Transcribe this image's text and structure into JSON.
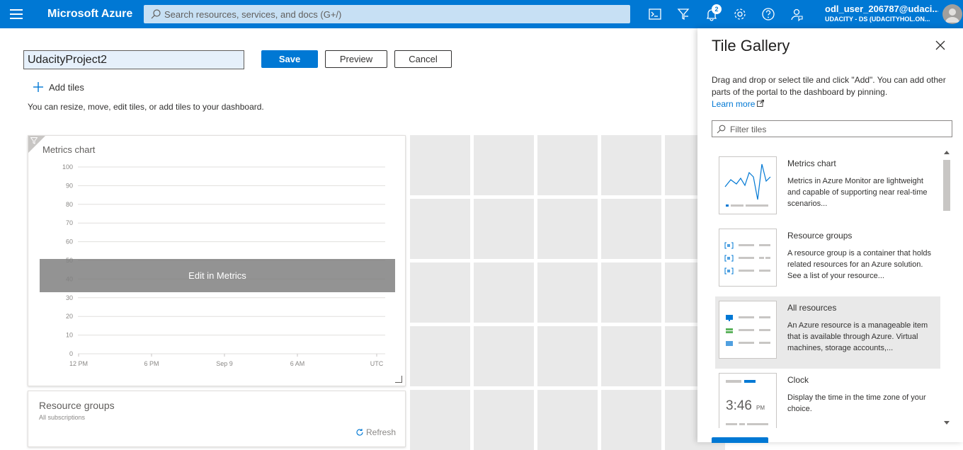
{
  "topbar": {
    "brand": "Microsoft Azure",
    "search_placeholder": "Search resources, services, and docs (G+/)",
    "notification_count": "2",
    "account_name": "odl_user_206787@udaci...",
    "account_org": "UDACITY - DS (UDACITYHOL.ON..."
  },
  "editor": {
    "dashboard_name": "UdacityProject2",
    "save_label": "Save",
    "preview_label": "Preview",
    "cancel_label": "Cancel",
    "add_tiles_label": "Add tiles",
    "helper_text": "You can resize, move, edit tiles, or add tiles to your dashboard."
  },
  "metrics_tile": {
    "title": "Metrics chart",
    "overlay_label": "Edit in Metrics"
  },
  "chart_data": {
    "type": "line",
    "title": "Metrics chart",
    "y_ticks": [
      "100",
      "90",
      "80",
      "70",
      "60",
      "50",
      "40",
      "30",
      "20",
      "10",
      "0"
    ],
    "x_ticks": [
      "12 PM",
      "6 PM",
      "Sep 9",
      "6 AM",
      "UTC"
    ],
    "ylim": [
      0,
      100
    ],
    "series": []
  },
  "resource_groups_tile": {
    "title": "Resource groups",
    "subtitle": "All subscriptions",
    "refresh_label": "Refresh"
  },
  "tile_gallery": {
    "title": "Tile Gallery",
    "description": "Drag and drop or select tile and click \"Add\". You can add other parts of the portal to the dashboard by pinning.",
    "learn_more": "Learn more",
    "filter_placeholder": "Filter tiles",
    "items": [
      {
        "name": "Metrics chart",
        "description": "Metrics in Azure Monitor are lightweight and capable of supporting near real-time scenarios..."
      },
      {
        "name": "Resource groups",
        "description": "A resource group is a container that holds related resources for an Azure solution. See a list of your resource..."
      },
      {
        "name": "All resources",
        "description": "An Azure resource is a manageable item that is available through Azure. Virtual machines, storage accounts,..."
      },
      {
        "name": "Clock",
        "description": "Display the time in the time zone of your choice.",
        "preview_time": "3:46",
        "preview_period": "PM"
      }
    ]
  },
  "colors": {
    "azure_blue": "#0078d4",
    "tile_gray": "#e9e9e9"
  }
}
